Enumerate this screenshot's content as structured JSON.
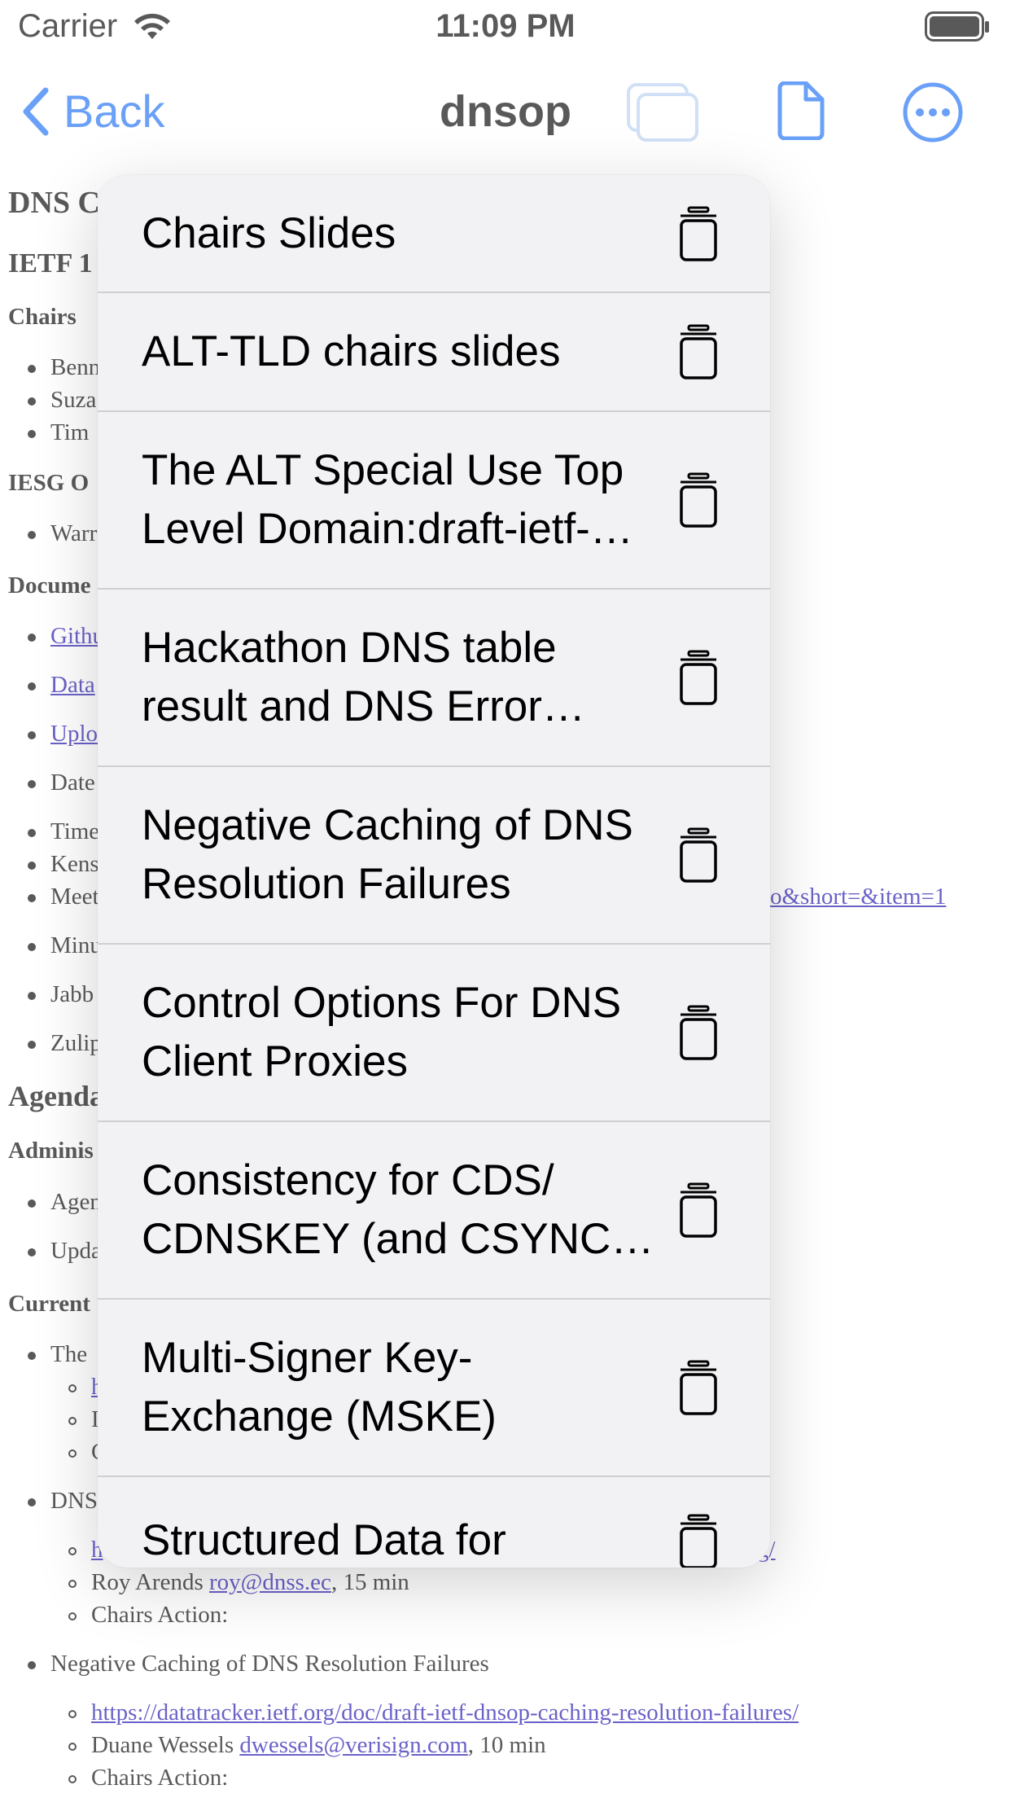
{
  "status_bar": {
    "carrier": "Carrier",
    "time": "11:09 PM"
  },
  "nav": {
    "back_label": "Back",
    "title": "dnsop"
  },
  "page": {
    "lines": [
      {
        "t": "DNS C"
      },
      {
        "t": "IETF 1"
      },
      {
        "t": "Chairs"
      },
      {
        "t": "Benn"
      },
      {
        "t": "Suza"
      },
      {
        "t": "Tim"
      },
      {
        "t": "IESG O"
      },
      {
        "t": "Warr"
      },
      {
        "t": "Docume"
      },
      {
        "t": "Githu"
      },
      {
        "t": "Data"
      },
      {
        "t": "Uplo"
      },
      {
        "t": "Date"
      },
      {
        "t": "Time"
      },
      {
        "t": "Kens"
      },
      {
        "t": "Meet"
      },
      {
        "t": "o&short=&item=1"
      },
      {
        "t": "Minu"
      },
      {
        "t": "Jabb"
      },
      {
        "t": "Zulip"
      },
      {
        "t": "Agenda"
      },
      {
        "t": "Adminis"
      },
      {
        "t": "Agen"
      },
      {
        "t": "Upda"
      },
      {
        "t": "Current"
      },
      {
        "t": "The"
      },
      {
        "t": "h"
      },
      {
        "t": "I"
      },
      {
        "t": "C"
      },
      {
        "t": "DNS"
      },
      {
        "t": "h"
      },
      {
        "t": "g/"
      },
      {
        "t": "Roy Arends "
      },
      {
        "t": "roy@dnss.ec"
      },
      {
        "t": ", 15 min"
      },
      {
        "t": "Chairs Action:"
      },
      {
        "t": "Negative Caching of DNS Resolution Failures"
      },
      {
        "t": "https://datatracker.ietf.org/doc/draft-ietf-dnsop-caching-resolution-failures/"
      },
      {
        "t": "Duane Wessels "
      },
      {
        "t": "dwessels@verisign.com"
      },
      {
        "t": ", 10 min"
      },
      {
        "t": "Chairs Action:"
      }
    ]
  },
  "menu": {
    "items": [
      {
        "label": "Chairs Slides"
      },
      {
        "label": "ALT-TLD chairs slides"
      },
      {
        "label": "The ALT Special Use Top Level Domain:draft-ietf-dnsop-alt-tld"
      },
      {
        "label": "Hackathon DNS table result and DNS Error Reporting"
      },
      {
        "label": "Negative Caching of DNS Resolution Failures"
      },
      {
        "label": "Control Options For DNS Client Proxies"
      },
      {
        "label": "Consistency for CDS/ CDNSKEY (and CSYNC) Updates"
      },
      {
        "label": "Multi-Signer Key-Exchange (MSKE)"
      },
      {
        "label": "Structured Data for"
      }
    ],
    "item_icon": "trash-icon"
  },
  "colors": {
    "accent": "#1b6ef3",
    "menu_bg": "#f2f2f5",
    "link": "#1a0dab"
  }
}
